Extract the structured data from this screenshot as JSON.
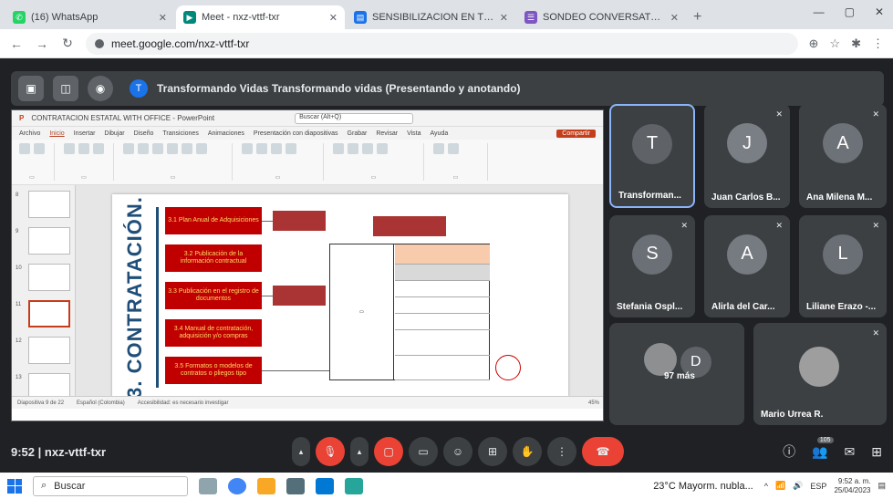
{
  "browser": {
    "tabs": [
      {
        "title": "(16) WhatsApp",
        "color": "#25d366",
        "icon": "whatsapp-icon"
      },
      {
        "title": "Meet - nxz-vttf-txr",
        "color": "#00897b",
        "icon": "meet-icon"
      },
      {
        "title": "SENSIBILIZACION EN TRANSF",
        "color": "#1a73e8",
        "icon": "document-icon"
      },
      {
        "title": "SONDEO CONVERSATORIO GO",
        "color": "#7e57c2",
        "icon": "forms-icon"
      }
    ],
    "new_tab": "+",
    "url": "meet.google.com/nxz-vttf-txr"
  },
  "meet": {
    "presenter_initial": "T",
    "presenting_text": "Transformando Vidas Transformando vidas (Presentando y anotando)",
    "participants": [
      {
        "initial": "T",
        "name": "Transforman...",
        "color": "#5f6368",
        "self": true
      },
      {
        "initial": "J",
        "name": "Juan Carlos B...",
        "color": "#7a7f85"
      },
      {
        "initial": "A",
        "name": "Ana Milena M...",
        "color": "#6d7278"
      },
      {
        "initial": "S",
        "name": "Stefania Ospl...",
        "color": "#6b7076"
      },
      {
        "initial": "A",
        "name": "Alirla del Car...",
        "color": "#767b81"
      },
      {
        "initial": "L",
        "name": "Liliane Erazo -...",
        "color": "#6a6f75"
      }
    ],
    "more": {
      "initial": "D",
      "label": "97 más"
    },
    "last_tile": {
      "name": "Mario Urrea R."
    },
    "clock": "9:52",
    "meeting_code": "nxz-vttf-txr",
    "people_count": "105"
  },
  "powerpoint": {
    "filename": "CONTRATACION ESTATAL WITH OFFICE - PowerPoint",
    "search_placeholder": "Buscar (Alt+Q)",
    "ribbon_tabs": [
      "Archivo",
      "Inicio",
      "Insertar",
      "Dibujar",
      "Diseño",
      "Transiciones",
      "Animaciones",
      "Presentación con diapositivas",
      "Grabar",
      "Revisar",
      "Vista",
      "Ayuda"
    ],
    "share_label": "Compartir",
    "slide_title": "3. CONTRATACIÓN.",
    "boxes": [
      "3.1 Plan Anual de Adquisiciones",
      "3.2 Publicación de la información contractual",
      "3.3 Publicación en el registro de documentos",
      "3.4 Manual de contratación, adquisición y/o compras",
      "3.5 Formatos o modelos de contratos o pliegos tipo"
    ],
    "status": "Diapositiva 9 de 22",
    "status_lang": "Español (Colombia)",
    "status_access": "Accesibilidad: es necesario investigar",
    "zoom": "45%"
  },
  "taskbar": {
    "search": "Buscar",
    "weather": "23°C Mayorm. nubla...",
    "lang": "ESP",
    "time": "9:52 a. m.",
    "date": "25/04/2023"
  }
}
